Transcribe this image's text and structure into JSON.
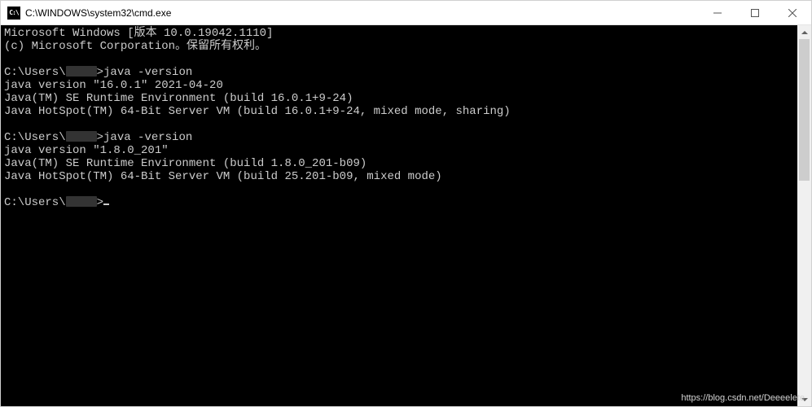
{
  "window": {
    "title": "C:\\WINDOWS\\system32\\cmd.exe",
    "icon_label": "C:\\"
  },
  "controls": {
    "minimize": "minimize-button",
    "maximize": "maximize-button",
    "close": "close-button"
  },
  "terminal": {
    "banner_line1": "Microsoft Windows [版本 10.0.19042.1110]",
    "banner_line2": "(c) Microsoft Corporation。保留所有权利。",
    "sessions": [
      {
        "prompt_prefix": "C:\\Users\\",
        "prompt_user_redacted": true,
        "prompt_suffix": ">",
        "command": "java -version",
        "output": [
          "java version \"16.0.1\" 2021-04-20",
          "Java(TM) SE Runtime Environment (build 16.0.1+9-24)",
          "Java HotSpot(TM) 64-Bit Server VM (build 16.0.1+9-24, mixed mode, sharing)"
        ]
      },
      {
        "prompt_prefix": "C:\\Users\\",
        "prompt_user_redacted": true,
        "prompt_suffix": ">",
        "command": "java -version",
        "output": [
          "java version \"1.8.0_201\"",
          "Java(TM) SE Runtime Environment (build 1.8.0_201-b09)",
          "Java HotSpot(TM) 64-Bit Server VM (build 25.201-b09, mixed mode)"
        ]
      }
    ],
    "current_prompt": {
      "prefix": "C:\\Users\\",
      "user_redacted": true,
      "suffix": ">"
    }
  },
  "watermark": "https://blog.csdn.net/Deeeelete"
}
